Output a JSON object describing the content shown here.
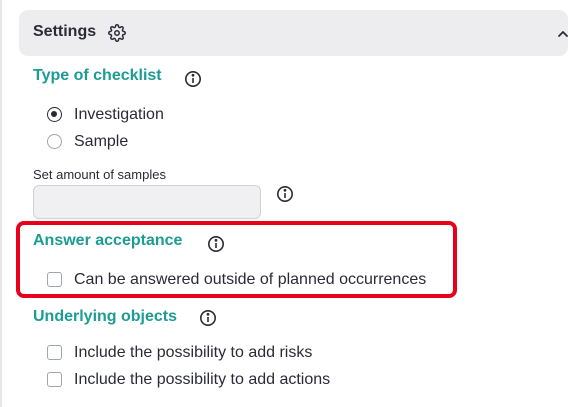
{
  "settings": {
    "title": "Settings",
    "gear_icon": "gear-icon",
    "collapse_icon": "chevron-up-icon"
  },
  "checklist_type": {
    "title": "Type of checklist",
    "info_icon": "info-icon",
    "options": [
      {
        "label": "Investigation",
        "selected": true
      },
      {
        "label": "Sample",
        "selected": false
      }
    ]
  },
  "samples": {
    "label": "Set amount of samples",
    "value": "",
    "info_icon": "info-icon"
  },
  "answer_acceptance": {
    "title": "Answer acceptance",
    "info_icon": "info-icon",
    "options": [
      {
        "label": "Can be answered outside of planned occurrences",
        "checked": false
      }
    ],
    "highlight_color": "#e8001b"
  },
  "underlying_objects": {
    "title": "Underlying objects",
    "info_icon": "info-icon",
    "options": [
      {
        "label": "Include the possibility to add risks",
        "checked": false
      },
      {
        "label": "Include the possibility to add actions",
        "checked": false
      }
    ]
  },
  "colors": {
    "accent": "#1c9c94",
    "text": "#2b2b38",
    "header_bg": "#ededf0",
    "highlight": "#e8001b"
  }
}
